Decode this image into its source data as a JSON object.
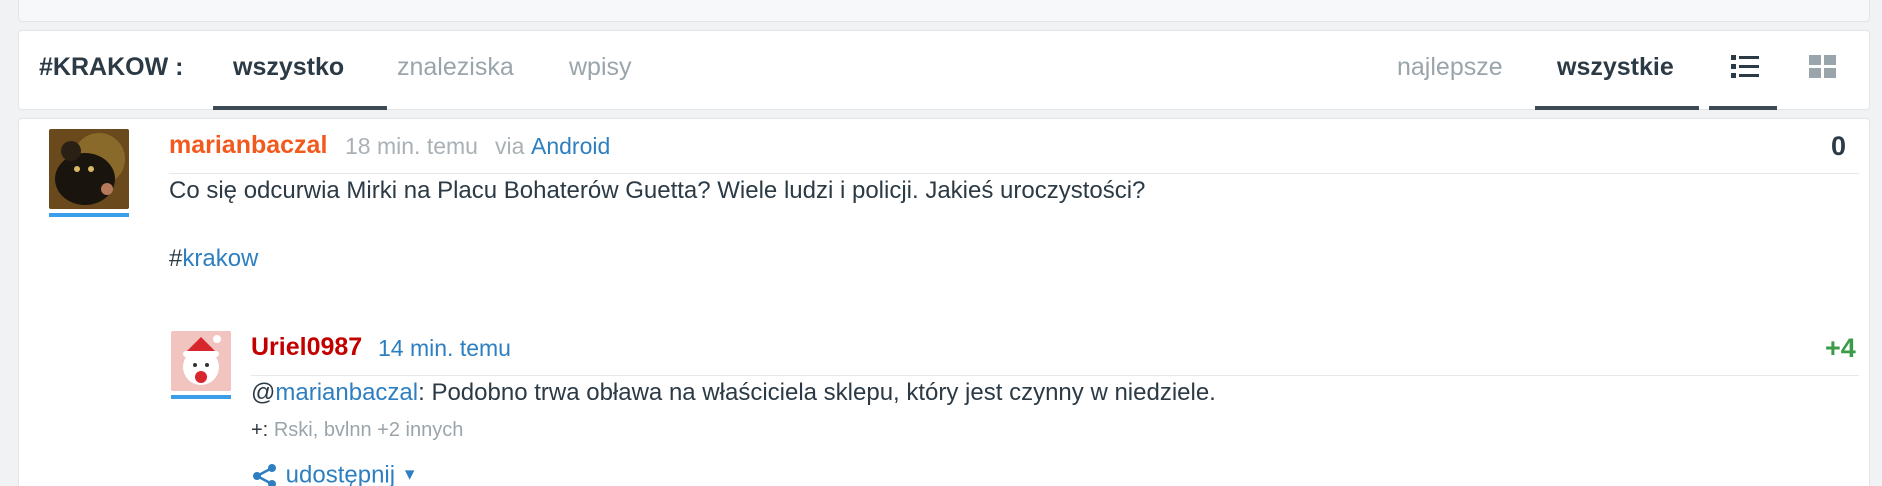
{
  "tag_title": "#KRAKOW :",
  "tabs": [
    "wszystko",
    "znaleziska",
    "wpisy"
  ],
  "sort_tabs": [
    "najlepsze",
    "wszystkie"
  ],
  "view_icons": [
    "list-view-icon",
    "grid-view-icon"
  ],
  "entry": {
    "author": "marianbaczal",
    "time": "18 min. temu",
    "via_label": "via",
    "via_app": "Android",
    "score": "0",
    "text": "Co się odcurwia Mirki na Placu Bohaterów Guetta? Wiele ludzi i policji. Jakieś uroczystości?",
    "hashtag_prefix": "#",
    "hashtag": "krakow"
  },
  "comment": {
    "author": "Uriel0987",
    "time": "14 min. temu",
    "score": "+4",
    "mention_prefix": "@",
    "mention": "marianbaczal",
    "text": ": Podobno trwa obława na właściciela sklepu, który jest czynny w niedziele.",
    "voters_prefix": "+:",
    "voters": "Rski, bvlnn +2 innych",
    "share_label": "udostępnij"
  },
  "colors": {
    "author_orange": "#f25a1d",
    "author_red": "#c20000",
    "link_blue": "#2d7fc1",
    "score_green": "#3c9b48",
    "dark": "#2b3a45"
  }
}
